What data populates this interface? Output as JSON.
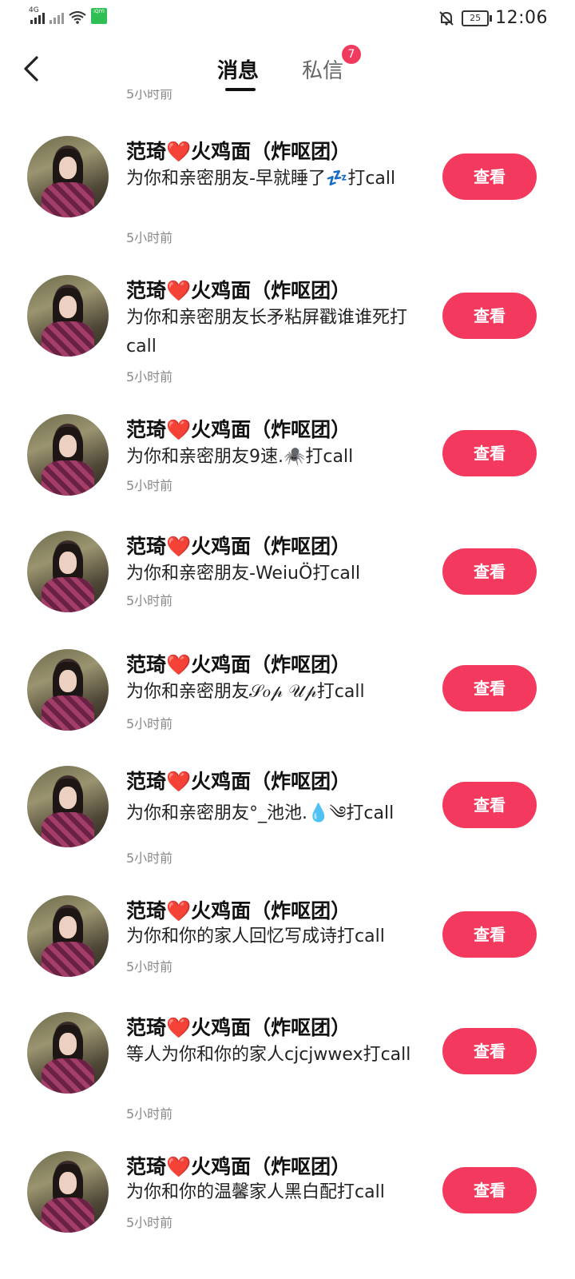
{
  "status_bar": {
    "network": "4G",
    "app_badge": "iQIYI",
    "battery": "25",
    "time": "12:06"
  },
  "header": {
    "tab_messages": "消息",
    "tab_dm": "私信",
    "dm_badge": "7"
  },
  "partial_time": "5小时前",
  "messages": [
    {
      "name": "范琦❤️火鸡面（炸呕团）",
      "text": "为你和亲密朋友-早就睡了💤打call",
      "time": "5小时前",
      "button": "查看"
    },
    {
      "name": "范琦❤️火鸡面（炸呕团）",
      "text": "为你和亲密朋友长矛粘屏戳谁谁死打call",
      "time": "5小时前",
      "button": "查看"
    },
    {
      "name": "范琦❤️火鸡面（炸呕团）",
      "text": "为你和亲密朋友9速.🕷️打call",
      "time": "5小时前",
      "button": "查看"
    },
    {
      "name": "范琦❤️火鸡面（炸呕团）",
      "text": "为你和亲密朋友-WeiuÖ打call",
      "time": "5小时前",
      "button": "查看"
    },
    {
      "name": "范琦❤️火鸡面（炸呕团）",
      "text": "为你和亲密朋友𝒮𝑜𝓅 𝒰𝓅打call",
      "time": "5小时前",
      "button": "查看"
    },
    {
      "name": "范琦❤️火鸡面（炸呕团）",
      "text": "为你和亲密朋友°_池池.💧༄打call",
      "time": "5小时前",
      "button": "查看"
    },
    {
      "name": "范琦❤️火鸡面（炸呕团）",
      "text": "为你和你的家人回忆写成诗打call",
      "time": "5小时前",
      "button": "查看"
    },
    {
      "name": "范琦❤️火鸡面（炸呕团）",
      "text": "等人为你和你的家人cjcjwwex打call",
      "time": "5小时前",
      "button": "查看"
    },
    {
      "name": "范琦❤️火鸡面（炸呕团）",
      "text": "为你和你的温馨家人黑白配打call",
      "time": "5小时前",
      "button": "查看"
    }
  ]
}
